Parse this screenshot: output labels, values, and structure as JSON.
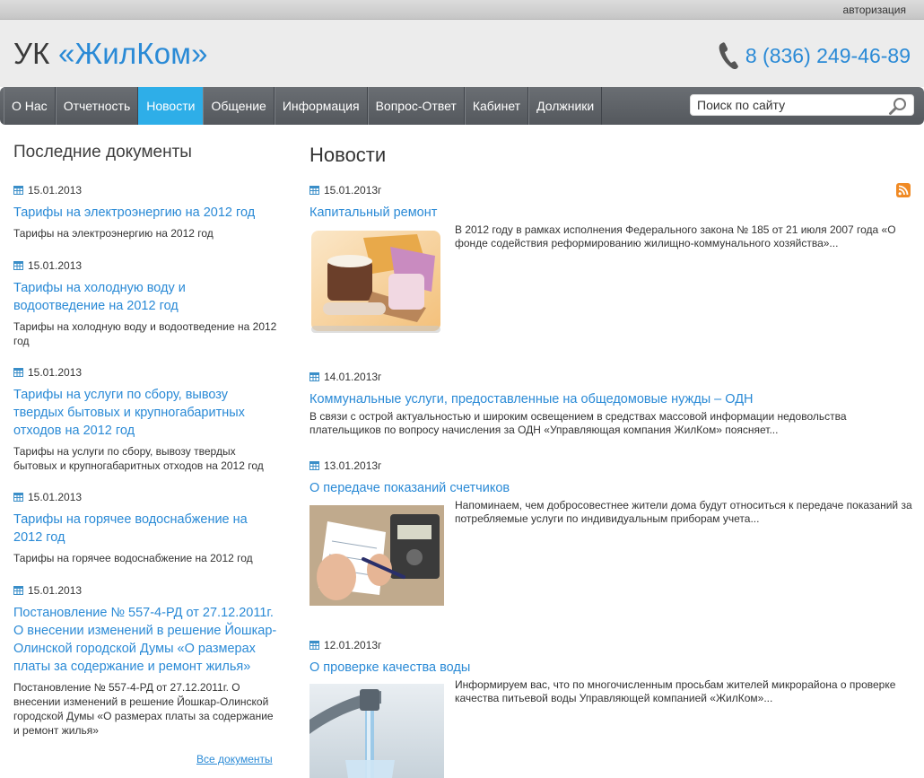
{
  "topbar": {
    "auth_link": "авторизация"
  },
  "header": {
    "logo_prefix": "УК ",
    "logo_brand": "«ЖилКом»",
    "phone": "8 (836) 249-46-89"
  },
  "nav": {
    "items": [
      "О Нас",
      "Отчетность",
      "Новости",
      "Общение",
      "Информация",
      "Вопрос-Ответ",
      "Кабинет",
      "Должники"
    ],
    "active": "Новости",
    "search_placeholder": "Поиск по сайту"
  },
  "sidebar": {
    "title": "Последние документы",
    "docs": [
      {
        "date": "15.01.2013",
        "title": "Тарифы на электроэнергию на 2012 год",
        "desc": "Тарифы на электроэнергию на 2012 год"
      },
      {
        "date": "15.01.2013",
        "title": "Тарифы на холодную воду и водоотведение на 2012 год",
        "desc": "Тарифы на холодную воду и водоотведение на 2012 год"
      },
      {
        "date": "15.01.2013",
        "title": "Тарифы на услуги по сбору, вывозу твердых бытовых и крупногабаритных отходов на 2012 год",
        "desc": "Тарифы на услуги по сбору, вывозу твердых бытовых и крупногабаритных отходов на 2012 год"
      },
      {
        "date": "15.01.2013",
        "title": "Тарифы на горячее водоснабжение на 2012 год",
        "desc": "Тарифы на горячее водоснабжение на 2012 год"
      },
      {
        "date": "15.01.2013",
        "title": "Постановление № 557-4-РД от 27.12.2011г. О внесении изменений в решение Йошкар-Олинской городской Думы «О размерах платы за содержание и ремонт жилья»",
        "desc": "Постановление № 557-4-РД от 27.12.2011г. О внесении изменений в решение Йошкар-Олинской городской Думы «О размерах платы за содержание и ремонт жилья»"
      }
    ],
    "all_docs_link": "Все документы"
  },
  "main": {
    "title": "Новости",
    "news": [
      {
        "date": "15.01.2013г",
        "title": "Капитальный ремонт",
        "text": "В 2012 году в рамках исполнения Федерального закона № 185 от 21 июля 2007 года «О фонде содействия реформированию жилищно-коммунального хозяйства»..."
      },
      {
        "date": "14.01.2013г",
        "title": "Коммунальные услуги, предоставленные на общедомовые нужды – ОДН",
        "text": "В связи с острой актуальностью и широким освещением в средствах массовой информации недовольства плательщиков по вопросу начисления за ОДН «Управляющая компания ЖилКом» поясняет..."
      },
      {
        "date": "13.01.2013г",
        "title": "О передаче показаний счетчиков",
        "text": "Напоминаем, чем добросовестнее жители дома будут относиться к передаче показаний за потребляемые услуги по индивидуальным приборам учета..."
      },
      {
        "date": "12.01.2013г",
        "title": "О проверке качества воды",
        "text": "Информируем вас, что по многочисленным просьбам жителей микрорайона о проверке качества питьевой воды Управляющей компанией «ЖилКом»..."
      }
    ]
  },
  "colors": {
    "accent": "#2a8ad6",
    "nav_active": "#2eaee8",
    "nav_bg": "#5e6267",
    "rss": "#f08a24"
  },
  "icons": {
    "phone": "phone-icon",
    "search": "search-icon",
    "calendar": "calendar-icon",
    "rss": "rss-icon"
  }
}
